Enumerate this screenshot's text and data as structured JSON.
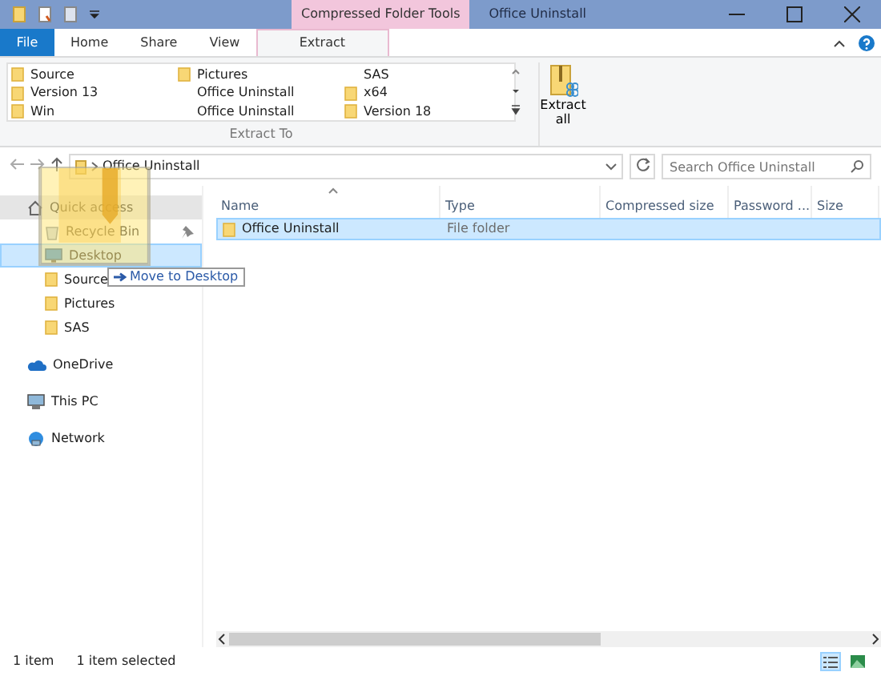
{
  "window": {
    "title": "Office Uninstall",
    "context_group": "Compressed Folder Tools"
  },
  "ribbon_tabs": [
    {
      "label": "File",
      "kind": "file",
      "selected": false
    },
    {
      "label": "Home",
      "kind": "tab",
      "selected": false
    },
    {
      "label": "Share",
      "kind": "tab",
      "selected": false
    },
    {
      "label": "View",
      "kind": "tab",
      "selected": false
    },
    {
      "label": "Extract",
      "kind": "context",
      "selected": true
    }
  ],
  "extract_to": {
    "group_label": "Extract To",
    "items": [
      {
        "label": "Source",
        "kind": "folder"
      },
      {
        "label": "Pictures",
        "kind": "folder"
      },
      {
        "label": "SAS",
        "kind": "plain"
      },
      {
        "label": "Version 13",
        "kind": "folder"
      },
      {
        "label": "Office Uninstall",
        "kind": "plain"
      },
      {
        "label": "x64",
        "kind": "folder"
      },
      {
        "label": "Win",
        "kind": "folder"
      },
      {
        "label": "Office Uninstall",
        "kind": "plain"
      },
      {
        "label": "Version 18",
        "kind": "folder"
      }
    ]
  },
  "extract_all": {
    "label": "Extract all"
  },
  "address": {
    "path": "Office Uninstall"
  },
  "search": {
    "placeholder": "Search Office Uninstall"
  },
  "nav": [
    {
      "label": "Quick access",
      "kind": "star",
      "selected": false,
      "hovered": true,
      "children": [
        {
          "label": "Recycle Bin",
          "kind": "recycle",
          "pinned": true,
          "selected": false,
          "hovered": false
        },
        {
          "label": "Desktop",
          "kind": "desktop",
          "pinned": false,
          "selected": true,
          "hovered": false
        },
        {
          "label": "Source",
          "kind": "folder",
          "pinned": false,
          "selected": false,
          "hovered": false
        },
        {
          "label": "Pictures",
          "kind": "folder",
          "pinned": false,
          "selected": false,
          "hovered": false
        },
        {
          "label": "SAS",
          "kind": "folder",
          "pinned": false,
          "selected": false,
          "hovered": false
        }
      ]
    },
    {
      "label": "OneDrive",
      "kind": "cloud",
      "selected": false,
      "hovered": false
    },
    {
      "label": "This PC",
      "kind": "pc",
      "selected": false,
      "hovered": false
    },
    {
      "label": "Network",
      "kind": "network",
      "selected": false,
      "hovered": false
    }
  ],
  "columns": [
    {
      "label": "Name",
      "sorted": true
    },
    {
      "label": "Type",
      "sorted": false
    },
    {
      "label": "Compressed size",
      "sorted": false
    },
    {
      "label": "Password ...",
      "sorted": false
    },
    {
      "label": "Size",
      "sorted": false
    }
  ],
  "rows": [
    {
      "name": "Office Uninstall",
      "type": "File folder",
      "selected": true
    }
  ],
  "drag_tooltip": "Move to Desktop",
  "status_bar": {
    "count": "1 item",
    "selection": "1 item selected"
  },
  "views": [
    {
      "kind": "details",
      "selected": true
    },
    {
      "kind": "large-icons",
      "selected": false
    }
  ]
}
